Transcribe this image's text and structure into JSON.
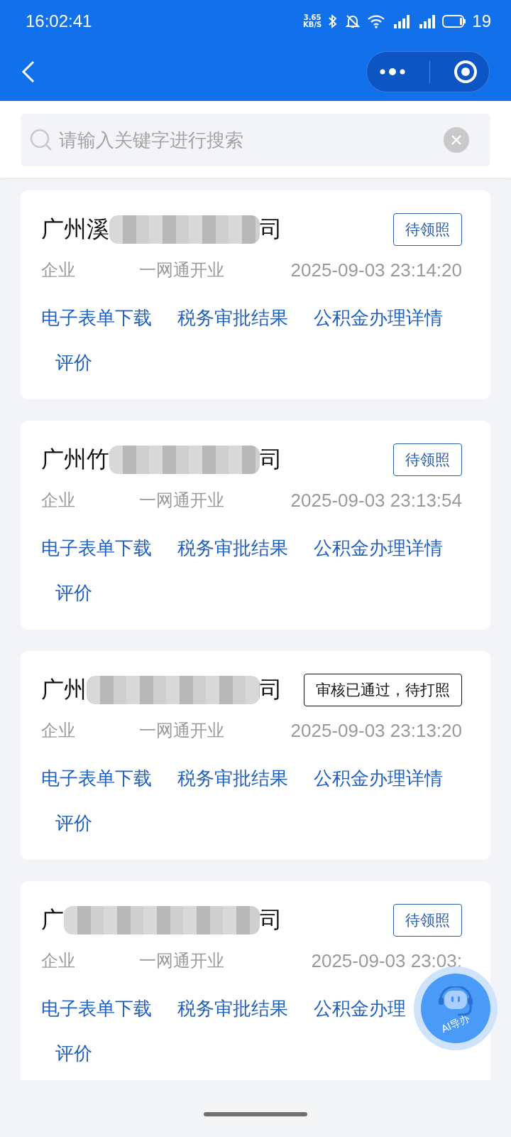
{
  "status_bar": {
    "time": "16:02:41",
    "net_speed_value": "3.65",
    "net_speed_unit": "KB/S",
    "battery": "19"
  },
  "search": {
    "placeholder": "请输入关键字进行搜索"
  },
  "records": [
    {
      "title_start": "广州溪",
      "title_end": "司",
      "status": {
        "label": "待领照",
        "kind": "waiting"
      },
      "type": "企业",
      "service": "一网通开业",
      "time": "2025-09-03 23:14:20",
      "links": [
        "电子表单下载",
        "税务审批结果",
        "公积金办理详情",
        "评价"
      ]
    },
    {
      "title_start": "广州竹",
      "title_end": "司",
      "status": {
        "label": "待领照",
        "kind": "waiting"
      },
      "type": "企业",
      "service": "一网通开业",
      "time": "2025-09-03 23:13:54",
      "links": [
        "电子表单下载",
        "税务审批结果",
        "公积金办理详情",
        "评价"
      ]
    },
    {
      "title_start": "广州",
      "title_end": "司",
      "status": {
        "label": "审核已通过，待打照",
        "kind": "approved"
      },
      "type": "企业",
      "service": "一网通开业",
      "time": "2025-09-03 23:13:20",
      "links": [
        "电子表单下载",
        "税务审批结果",
        "公积金办理详情",
        "评价"
      ]
    },
    {
      "title_start": "广",
      "title_end": "司",
      "status": {
        "label": "待领照",
        "kind": "waiting"
      },
      "type": "企业",
      "service": "一网通开业",
      "time": "2025-09-03 23:03:",
      "links": [
        "电子表单下载",
        "税务审批结果",
        "公积金办理",
        "评价"
      ]
    }
  ],
  "assistant_button": {
    "label": "AI导办"
  }
}
